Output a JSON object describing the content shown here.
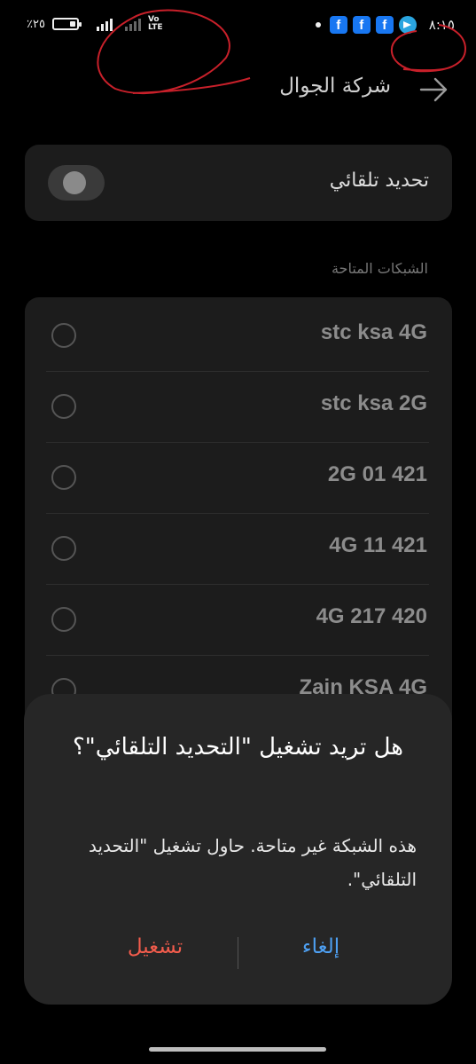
{
  "status_bar": {
    "battery_percent": "٪٢٥",
    "battery_level": 0.25,
    "network_type": "Vo\nLTE",
    "time": "٨:١٥",
    "notification_icons": [
      "facebook-icon",
      "facebook-icon",
      "facebook-icon",
      "telegram-icon"
    ],
    "fb_letter": "f"
  },
  "header": {
    "title": "شركة الجوال",
    "back_icon": "arrow-right-icon"
  },
  "auto_select": {
    "label": "تحديد تلقائي",
    "enabled": false
  },
  "networks_section": {
    "label": "الشبكات المتاحة",
    "items": [
      {
        "name": "stc ksa 4G"
      },
      {
        "name": "stc ksa 2G"
      },
      {
        "name": "2G 01 421"
      },
      {
        "name": "4G 11 421"
      },
      {
        "name": "4G 217 420"
      },
      {
        "name": "Zain KSA 4G"
      }
    ]
  },
  "dialog": {
    "title": "هل تريد تشغيل \"التحديد التلقائي\"؟",
    "message": "هذه الشبكة غير متاحة. حاول تشغيل \"التحديد التلقائي\".",
    "enable_label": "تشغيل",
    "cancel_label": "إلغاء"
  },
  "colors": {
    "background": "#000000",
    "card": "#1c1c1c",
    "dialog": "#262626",
    "enable_button": "#f25c4c",
    "cancel_button": "#4ea0f2",
    "annotation": "#c8202a"
  }
}
